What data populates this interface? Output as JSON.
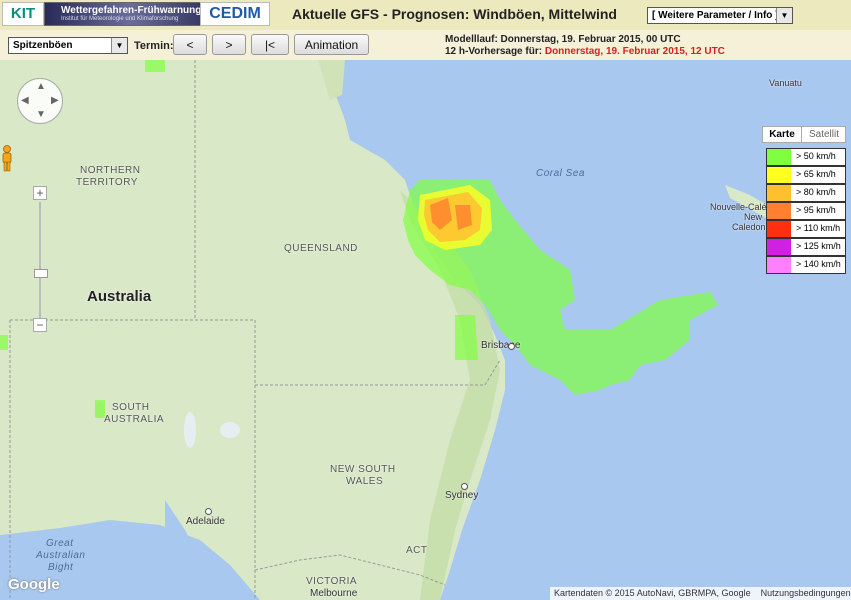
{
  "header": {
    "kit_logo": "KIT",
    "banner_title": "Wettergefahren-Frühwarnung",
    "banner_subtitle": "Institut für Meteorologie und Klimaforschung",
    "cedim_logo": "CEDIM",
    "title": "Aktuelle GFS - Prognosen: Windböen, Mittelwind",
    "param_select": "[ Weitere Parameter / Info ]"
  },
  "toolbar": {
    "parameter_select": "Spitzenböen",
    "termin_label": "Termin:",
    "prev_label": "<",
    "next_label": ">",
    "first_label": "|<",
    "animation_label": "Animation",
    "modelllauf": "Modelllauf: Donnerstag, 19. Februar 2015, 00 UTC",
    "vorhersage_prefix": "12 h-Vorhersage für: ",
    "vorhersage_value": "Donnerstag, 19. Februar 2015, 12 UTC"
  },
  "map": {
    "labels": {
      "northern_territory_1": "NORTHERN",
      "northern_territory_2": "TERRITORY",
      "queensland": "QUEENSLAND",
      "australia": "Australia",
      "south_australia_1": "SOUTH",
      "south_australia_2": "AUSTRALIA",
      "new_south_wales_1": "NEW SOUTH",
      "new_south_wales_2": "WALES",
      "victoria": "VICTORIA",
      "act": "ACT",
      "coral_sea": "Coral Sea",
      "great_australian_bight_1": "Great",
      "great_australian_bight_2": "Australian",
      "great_australian_bight_3": "Bight",
      "brisbane": "Brisbane",
      "sydney": "Sydney",
      "adelaide": "Adelaide",
      "melbourne": "Melbourne",
      "new_caledonia_1": "Nouvelle-Calé",
      "new_caledonia_2": "New",
      "new_caledonia_3": "Caledonia",
      "vanuatu": "Vanuatu"
    },
    "google_logo": "Google",
    "attribution": "Kartendaten © 2015 AutoNavi, GBRMPA, Google",
    "terms": "Nutzungsbedingungen",
    "zoom_in": "+",
    "zoom_out": "−"
  },
  "legend": {
    "tab_map": "Karte",
    "tab_satellite": "Satellit",
    "items": [
      {
        "label": "> 50 km/h",
        "color": "#80ff40"
      },
      {
        "label": "> 65 km/h",
        "color": "#ffff20"
      },
      {
        "label": "> 80 km/h",
        "color": "#ffc030"
      },
      {
        "label": "> 95 km/h",
        "color": "#ff8030"
      },
      {
        "label": "> 110 km/h",
        "color": "#ff3010"
      },
      {
        "label": "> 125 km/h",
        "color": "#d020e0"
      },
      {
        "label": "> 140 km/h",
        "color": "#ff80ff"
      }
    ]
  }
}
